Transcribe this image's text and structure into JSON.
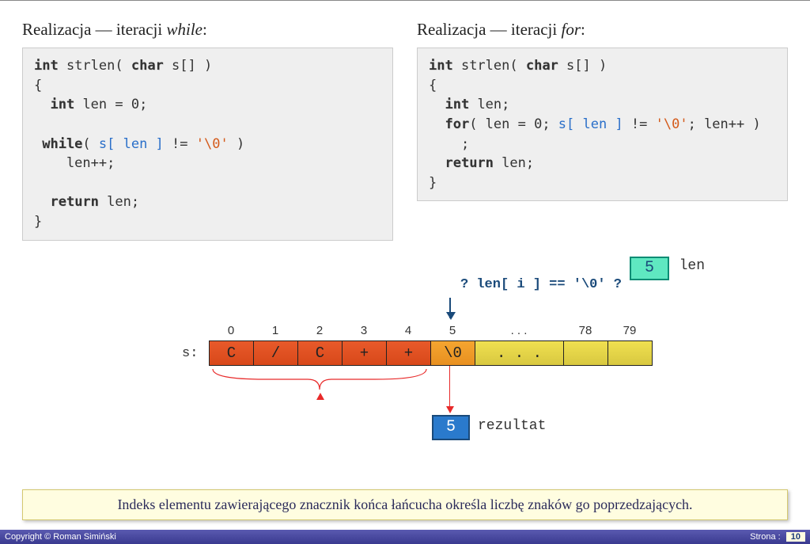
{
  "headings": {
    "while_title_prefix": "Realizacja — iteracji ",
    "while_title_ital": "while",
    "for_title_prefix": "Realizacja — iteracji ",
    "for_title_ital": "for",
    "colon": ":"
  },
  "code": {
    "while": {
      "l1_kw1": "int",
      "l1_id": " strlen( ",
      "l1_kw2": "char",
      "l1_rest": " s[] )",
      "l2": "{",
      "l3_pre": "  ",
      "l3_kw": "int",
      "l3_rest": " len = 0;",
      "l4": "",
      "l5_kw": " while",
      "l5_open": "( ",
      "l5_id1": "s[ len ]",
      "l5_mid": " != ",
      "l5_str": "'\\0'",
      "l5_close": " )",
      "l6": "    len++;",
      "l7": "",
      "l8_pre": "  ",
      "l8_kw": "return",
      "l8_rest": " len;",
      "l9": "}"
    },
    "for": {
      "l1_kw1": "int",
      "l1_id": " strlen( ",
      "l1_kw2": "char",
      "l1_rest": " s[] )",
      "l2": "{",
      "l3_pre": "  ",
      "l3_kw": "int",
      "l3_rest": " len;",
      "l4_pre": "  ",
      "l4_kw": "for",
      "l4_a": "( len = 0; ",
      "l4_id": "s[ len ]",
      "l4_b": " != ",
      "l4_str": "'\\0'",
      "l4_c": "; len++ )",
      "l5": "    ;",
      "l6_pre": "  ",
      "l6_kw": "return",
      "l6_rest": " len;",
      "l7": "}"
    }
  },
  "diagram": {
    "len_value": "5",
    "len_label": "len",
    "condition": "? len[ i ] == '\\0' ?",
    "s_label": "s:",
    "indices": [
      "0",
      "1",
      "2",
      "3",
      "4",
      "5"
    ],
    "indices_dots": ". . .",
    "indices_tail": [
      "78",
      "79"
    ],
    "cells": [
      "C",
      "/",
      "C",
      "+",
      "+",
      "\\0"
    ],
    "cells_dots": ". . .",
    "result_value": "5",
    "result_label": "rezultat"
  },
  "note": "Indeks elementu zawierającego znacznik końca łańcucha określa liczbę znaków go poprzedzających.",
  "footer": {
    "copyright": "Copyright © Roman Simiński",
    "page_label": "Strona :",
    "page_num": "10"
  }
}
